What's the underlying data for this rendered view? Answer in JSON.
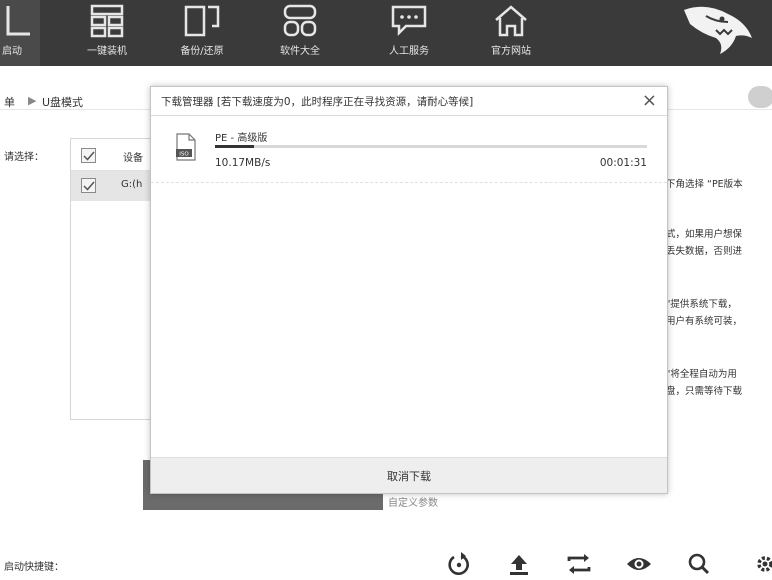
{
  "nav": {
    "items": [
      {
        "label": "启动",
        "icon": "boot-icon"
      },
      {
        "label": "一键装机",
        "icon": "grid-icon"
      },
      {
        "label": "备份/还原",
        "icon": "backup-icon"
      },
      {
        "label": "软件大全",
        "icon": "apps-icon"
      },
      {
        "label": "人工服务",
        "icon": "chat-icon"
      },
      {
        "label": "官方网站",
        "icon": "home-icon"
      }
    ]
  },
  "breadcrumb": {
    "root": "单",
    "separator": "▶",
    "current": "U盘模式"
  },
  "left_panel": {
    "select_label": "请选择：",
    "header_text": "设备",
    "device_text": "G:(h"
  },
  "right_text": {
    "line1": "下角选择 “PE版本",
    "line2a": "式，如果用户想保",
    "line2b": "丢失数据，否则进",
    "line3a": "\"提供系统下载，",
    "line3b": "用户有系统可装，",
    "line4a": "\"将全程自动为用",
    "line4b": "盘，只需等待下载"
  },
  "bottom": {
    "custom_params": "自定义参数",
    "hotkey_label": "启动快捷键：",
    "tools": [
      "restore-icon",
      "upload-icon",
      "swap-icon",
      "eye-icon",
      "search-icon",
      "gear-icon"
    ]
  },
  "modal": {
    "title": "下载管理器 [若下载速度为0，此时程序正在寻找资源，请耐心等候]",
    "close": "×",
    "item": {
      "file_badge": "ISO",
      "name": "PE - 高级版",
      "speed": "10.17MB/s",
      "time": "00:01:31",
      "progress_pct": 9
    },
    "cancel_label": "取消下载"
  },
  "colors": {
    "topbar": "#3a3a3a",
    "progress": "#333333",
    "modal_footer": "#eeeeee"
  }
}
